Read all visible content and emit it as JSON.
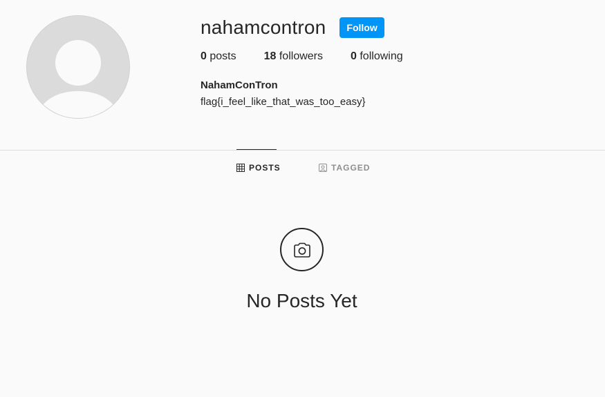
{
  "profile": {
    "username": "nahamcontron",
    "follow_label": "Follow",
    "full_name": "NahamConTron",
    "bio": "flag{i_feel_like_that_was_too_easy}",
    "avatar_icon": "default-avatar-icon"
  },
  "stats": {
    "posts_count": "0",
    "posts_label": "posts",
    "followers_count": "18",
    "followers_label": "followers",
    "following_count": "0",
    "following_label": "following"
  },
  "tabs": [
    {
      "label": "POSTS",
      "icon": "grid-icon",
      "active": true
    },
    {
      "label": "TAGGED",
      "icon": "tagged-icon",
      "active": false
    }
  ],
  "empty_state": {
    "icon": "camera-icon",
    "title": "No Posts Yet"
  },
  "colors": {
    "accent": "#0095f6",
    "background": "#fafafa",
    "text": "#262626",
    "muted": "#8e8e8e"
  }
}
